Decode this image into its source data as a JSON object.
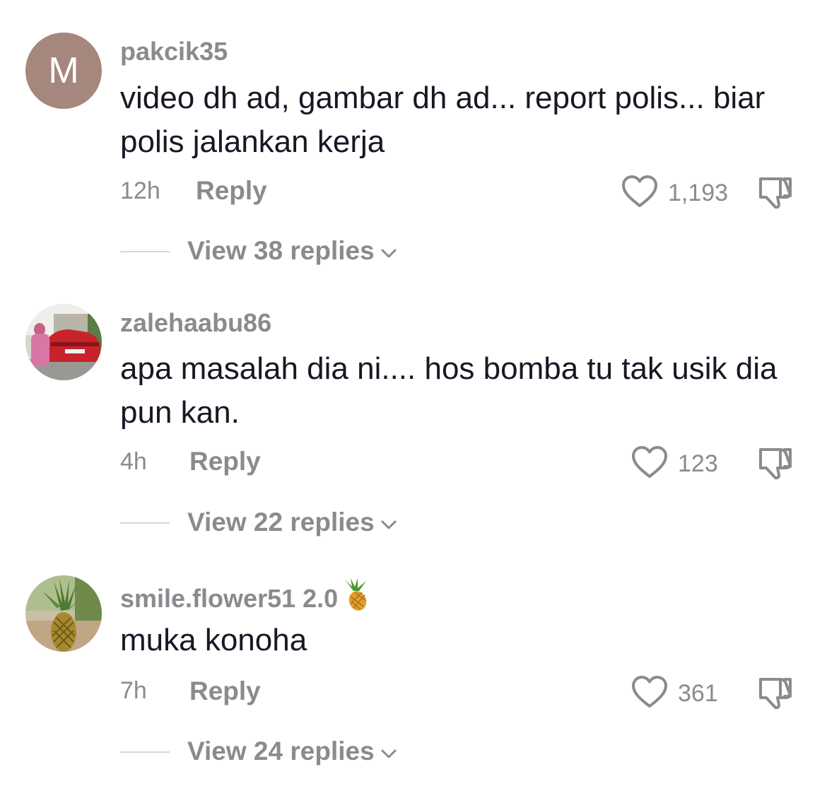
{
  "comments": [
    {
      "avatar_letter": "M",
      "username": "pakcik35",
      "text": "video dh ad, gambar dh ad... report polis... biar polis jalankan kerja",
      "time": "12h",
      "reply_label": "Reply",
      "likes": "1,193",
      "view_replies": "View 38 replies"
    },
    {
      "username": "zalehaabu86",
      "text": "apa masalah dia ni.... hos bomba tu tak usik dia pun kan.",
      "time": "4h",
      "reply_label": "Reply",
      "likes": "123",
      "view_replies": "View 22 replies"
    },
    {
      "username": "smile.flower51 2.0",
      "username_emoji": "pineapple",
      "text": "muka konoha",
      "time": "7h",
      "reply_label": "Reply",
      "likes": "361",
      "view_replies": "View 24 replies"
    }
  ],
  "colors": {
    "text": "#161823",
    "secondary": "#8a8a8f",
    "avatar_bg": "#a5877d"
  }
}
